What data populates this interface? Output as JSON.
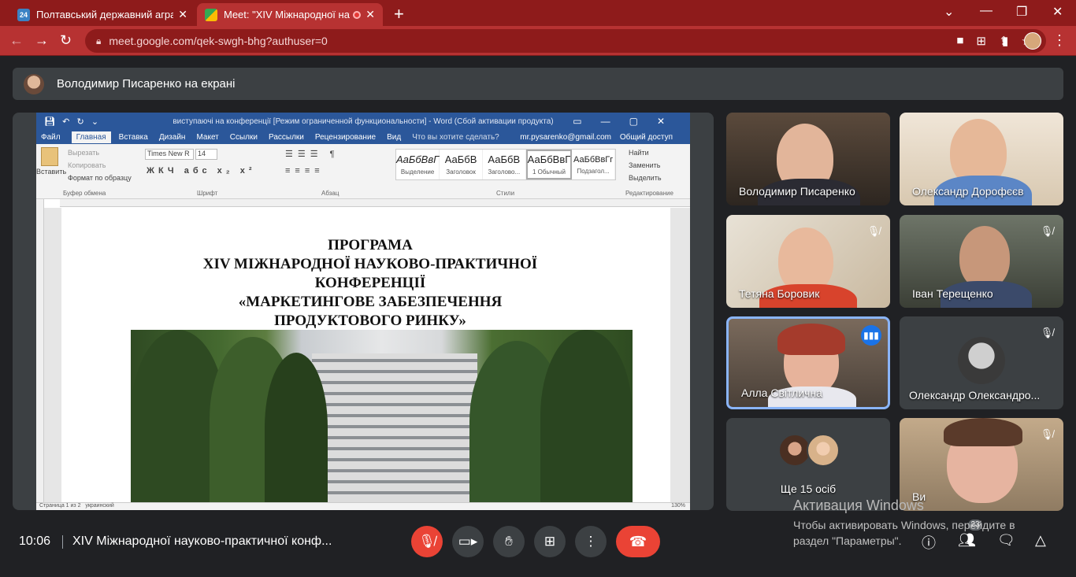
{
  "browser": {
    "tabs": [
      {
        "title": "Полтавський державний аграрн",
        "favicon": "24"
      },
      {
        "title": "Meet: \"XIV Міжнародної нау"
      }
    ],
    "url": "meet.google.com/qek-swgh-bhg?authuser=0",
    "accent": "#b73232"
  },
  "presentation": {
    "banner": "Володимир Писаренко на екрані"
  },
  "word": {
    "window_title": "виступаючі на конференції [Режим ограниченной функциональности] - Word (Сбой активации продукта)",
    "menu": [
      "Файл",
      "Главная",
      "Вставка",
      "Дизайн",
      "Макет",
      "Ссылки",
      "Рассылки",
      "Рецензирование",
      "Вид"
    ],
    "tell_me": "Что вы хотите сделать?",
    "account": "mr.pysarenko@gmail.com",
    "share": "Общий доступ",
    "clipboard": {
      "paste": "Вставить",
      "cut": "Вырезать",
      "copy": "Копировать",
      "painter": "Формат по образцу",
      "group": "Буфер обмена"
    },
    "font": {
      "name": "Times New R",
      "size": "14",
      "group": "Шрифт"
    },
    "paragraph_group": "Абзац",
    "styles": [
      {
        "sample": "АаБбВвГ",
        "label": "Выделение"
      },
      {
        "sample": "АаБбВ",
        "label": "Заголовок"
      },
      {
        "sample": "АаБбВ",
        "label": "Заголово..."
      },
      {
        "sample": "АаБбВвГ",
        "label": "1 Обычный"
      },
      {
        "sample": "АаБбВвГг",
        "label": "Подзагол..."
      }
    ],
    "styles_group": "Стили",
    "editing": {
      "find": "Найти",
      "replace": "Заменить",
      "select": "Выделить",
      "group": "Редактирование"
    },
    "heading_lines": [
      "ПРОГРАМА",
      "XIV МІЖНАРОДНОЇ НАУКОВО-ПРАКТИЧНОЇ",
      "КОНФЕРЕНЦІЇ",
      "«МАРКЕТИНГОВЕ ЗАБЕЗПЕЧЕННЯ",
      "ПРОДУКТОВОГО РИНКУ»"
    ],
    "status": {
      "page": "Страница 1 из 2",
      "lang": "украинский",
      "zoom": "130%"
    }
  },
  "participants": [
    {
      "name": "Володимир Писаренко",
      "muted": false
    },
    {
      "name": "Олександр Дорофєєв",
      "muted": false
    },
    {
      "name": "Тетяна Боровик",
      "muted": true
    },
    {
      "name": "Іван Терещенко",
      "muted": true
    },
    {
      "name": "Алла Світлична",
      "muted": false,
      "speaking": true
    },
    {
      "name": "Олександр Олександро...",
      "muted": true
    },
    {
      "name": "Ще 15 осіб"
    },
    {
      "name": "Ви",
      "muted": true
    }
  ],
  "bottom": {
    "time": "10:06",
    "meeting_name": "XIV Міжнародної науково-практичної конф...",
    "people_count": "23"
  },
  "activation": {
    "title": "Активация Windows",
    "line1": "Чтобы активировать Windows, перейдите в",
    "line2": "раздел \"Параметры\"."
  }
}
